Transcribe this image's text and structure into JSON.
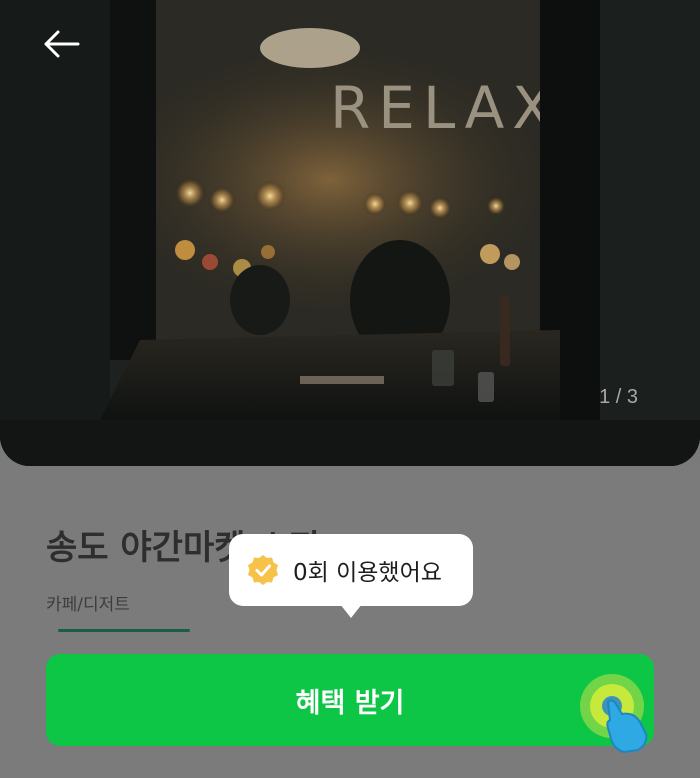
{
  "header": {
    "back_icon": "arrow-left-icon",
    "signage_text": "RELAX"
  },
  "gallery": {
    "page_indicator": "1 / 3",
    "current_page": 1,
    "total_pages": 3
  },
  "shop": {
    "title": "송도 야간마켓 쇼핑",
    "category": "카페/디저트"
  },
  "tooltip": {
    "icon": "verified-badge-icon",
    "text": "0회 이용했어요"
  },
  "cta": {
    "label": "혜택 받기",
    "color": "#0dc645"
  },
  "tap_indicator": {
    "icon": "tap-hand-icon"
  }
}
